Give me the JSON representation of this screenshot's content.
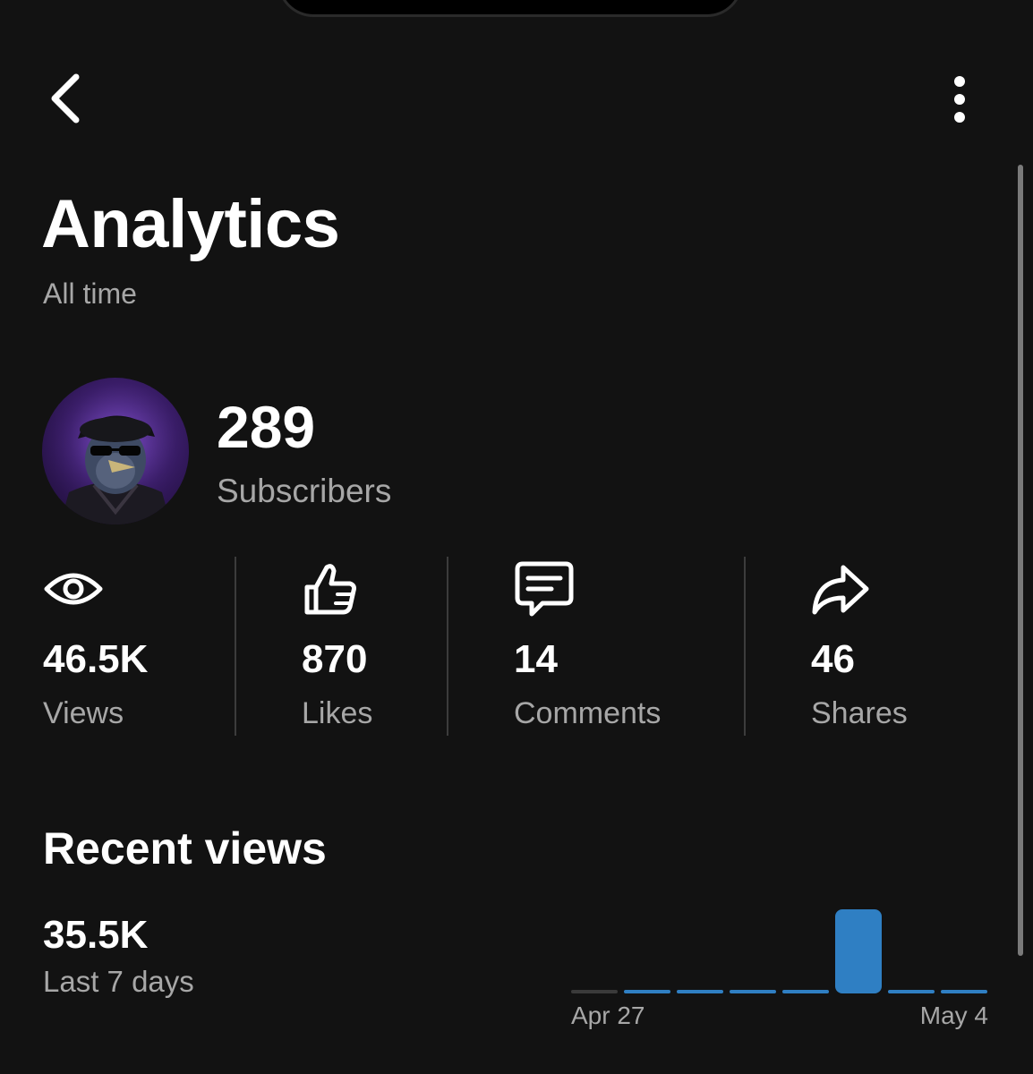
{
  "header": {
    "back_icon": "chevron-left-icon",
    "more_icon": "vertical-ellipsis-icon"
  },
  "page": {
    "title": "Analytics",
    "subtitle": "All time"
  },
  "profile": {
    "subscribers_value": "289",
    "subscribers_label": "Subscribers"
  },
  "stats": [
    {
      "icon": "eye-icon",
      "value": "46.5K",
      "label": "Views"
    },
    {
      "icon": "thumbs-up-icon",
      "value": "870",
      "label": "Likes"
    },
    {
      "icon": "comment-icon",
      "value": "14",
      "label": "Comments"
    },
    {
      "icon": "share-icon",
      "value": "46",
      "label": "Shares"
    }
  ],
  "recent": {
    "title": "Recent views",
    "value": "35.5K",
    "period_label": "Last 7 days"
  },
  "chart_data": {
    "type": "bar",
    "x_start_label": "Apr 27",
    "x_end_label": "May 4",
    "values": [
      0,
      350,
      350,
      350,
      350,
      32500,
      900,
      650
    ],
    "colors": {
      "bar": "#2f7fc3",
      "zero_bar": "#3a3a3a"
    }
  },
  "colors": {
    "background": "#121212",
    "text_primary": "#ffffff",
    "text_secondary": "#a7a7a7",
    "accent_bar": "#2f7fc3"
  }
}
